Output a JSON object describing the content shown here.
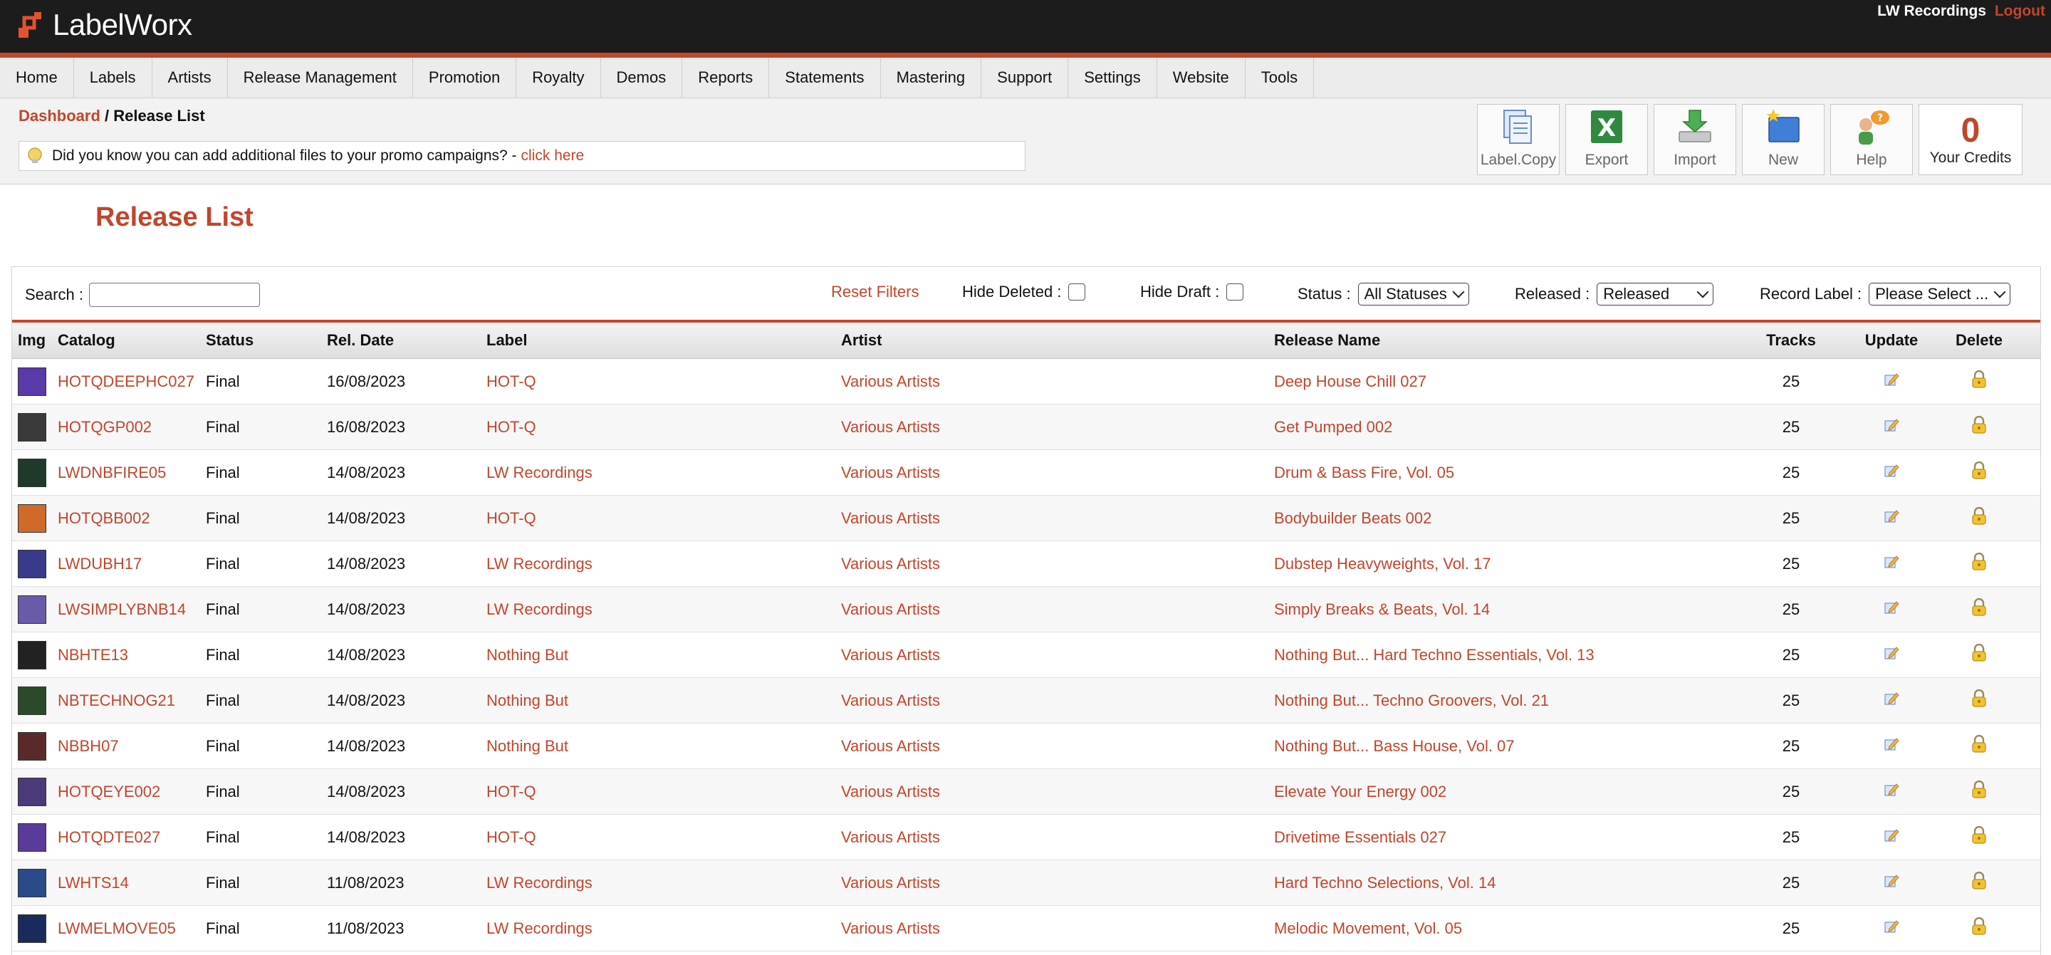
{
  "header": {
    "logo_text": "LabelWorx",
    "account_name": "LW Recordings",
    "logout_label": "Logout",
    "accent_color": "#c0462c"
  },
  "nav": [
    "Home",
    "Labels",
    "Artists",
    "Release Management",
    "Promotion",
    "Royalty",
    "Demos",
    "Reports",
    "Statements",
    "Mastering",
    "Support",
    "Settings",
    "Website",
    "Tools"
  ],
  "breadcrumb": {
    "home": "Dashboard",
    "separator": " / ",
    "current": "Release List"
  },
  "tip": {
    "icon": "lightbulb-icon",
    "text": "Did you know you can add additional files to your promo campaigns? -",
    "link": "click here"
  },
  "toolbar": {
    "buttons": [
      {
        "label": "Label.Copy",
        "icon": "label-copy-icon"
      },
      {
        "label": "Export",
        "icon": "excel-export-icon"
      },
      {
        "label": "Import",
        "icon": "import-icon"
      },
      {
        "label": "New",
        "icon": "new-folder-icon"
      },
      {
        "label": "Help",
        "icon": "help-icon"
      }
    ],
    "credits_value": "0",
    "credits_label": "Your Credits"
  },
  "page_title": "Release List",
  "filters": {
    "search_label": "Search :",
    "search_value": "",
    "reset_label": "Reset Filters",
    "hide_deleted_label": "Hide Deleted :",
    "hide_draft_label": "Hide Draft :",
    "status_label": "Status :",
    "status_value": "All Statuses",
    "released_label": "Released :",
    "released_value": "Released",
    "record_label_label": "Record Label :",
    "record_label_value": "Please Select ..."
  },
  "table": {
    "headers": [
      "Img",
      "Catalog",
      "Status",
      "Rel. Date",
      "Label",
      "Artist",
      "Release Name",
      "Tracks",
      "Update",
      "Delete"
    ],
    "rows": [
      {
        "catalog": "HOTQDEEPHC027",
        "status": "Final",
        "date": "16/08/2023",
        "label": "HOT-Q",
        "artist": "Various Artists",
        "release": "Deep House Chill 027",
        "tracks": "25",
        "thumb_color": "#5a3aa8"
      },
      {
        "catalog": "HOTQGP002",
        "status": "Final",
        "date": "16/08/2023",
        "label": "HOT-Q",
        "artist": "Various Artists",
        "release": "Get Pumped 002",
        "tracks": "25",
        "thumb_color": "#3a3a3a"
      },
      {
        "catalog": "LWDNBFIRE05",
        "status": "Final",
        "date": "14/08/2023",
        "label": "LW Recordings",
        "artist": "Various Artists",
        "release": "Drum & Bass Fire, Vol. 05",
        "tracks": "25",
        "thumb_color": "#1f3a2a"
      },
      {
        "catalog": "HOTQBB002",
        "status": "Final",
        "date": "14/08/2023",
        "label": "HOT-Q",
        "artist": "Various Artists",
        "release": "Bodybuilder Beats 002",
        "tracks": "25",
        "thumb_color": "#d06a2a"
      },
      {
        "catalog": "LWDUBH17",
        "status": "Final",
        "date": "14/08/2023",
        "label": "LW Recordings",
        "artist": "Various Artists",
        "release": "Dubstep Heavyweights, Vol. 17",
        "tracks": "25",
        "thumb_color": "#3a3a8a"
      },
      {
        "catalog": "LWSIMPLYBNB14",
        "status": "Final",
        "date": "14/08/2023",
        "label": "LW Recordings",
        "artist": "Various Artists",
        "release": "Simply Breaks & Beats, Vol. 14",
        "tracks": "25",
        "thumb_color": "#6a5aa8"
      },
      {
        "catalog": "NBHTE13",
        "status": "Final",
        "date": "14/08/2023",
        "label": "Nothing But",
        "artist": "Various Artists",
        "release": "Nothing But... Hard Techno Essentials, Vol. 13",
        "tracks": "25",
        "thumb_color": "#222222"
      },
      {
        "catalog": "NBTECHNOG21",
        "status": "Final",
        "date": "14/08/2023",
        "label": "Nothing But",
        "artist": "Various Artists",
        "release": "Nothing But... Techno Groovers, Vol. 21",
        "tracks": "25",
        "thumb_color": "#2a4a2a"
      },
      {
        "catalog": "NBBH07",
        "status": "Final",
        "date": "14/08/2023",
        "label": "Nothing But",
        "artist": "Various Artists",
        "release": "Nothing But... Bass House, Vol. 07",
        "tracks": "25",
        "thumb_color": "#5a2a2a"
      },
      {
        "catalog": "HOTQEYE002",
        "status": "Final",
        "date": "14/08/2023",
        "label": "HOT-Q",
        "artist": "Various Artists",
        "release": "Elevate Your Energy 002",
        "tracks": "25",
        "thumb_color": "#4a3a7a"
      },
      {
        "catalog": "HOTQDTE027",
        "status": "Final",
        "date": "14/08/2023",
        "label": "HOT-Q",
        "artist": "Various Artists",
        "release": "Drivetime Essentials 027",
        "tracks": "25",
        "thumb_color": "#5a3a9a"
      },
      {
        "catalog": "LWHTS14",
        "status": "Final",
        "date": "11/08/2023",
        "label": "LW Recordings",
        "artist": "Various Artists",
        "release": "Hard Techno Selections, Vol. 14",
        "tracks": "25",
        "thumb_color": "#2a4a8a"
      },
      {
        "catalog": "LWMELMOVE05",
        "status": "Final",
        "date": "11/08/2023",
        "label": "LW Recordings",
        "artist": "Various Artists",
        "release": "Melodic Movement, Vol. 05",
        "tracks": "25",
        "thumb_color": "#1a2a5a"
      }
    ]
  }
}
